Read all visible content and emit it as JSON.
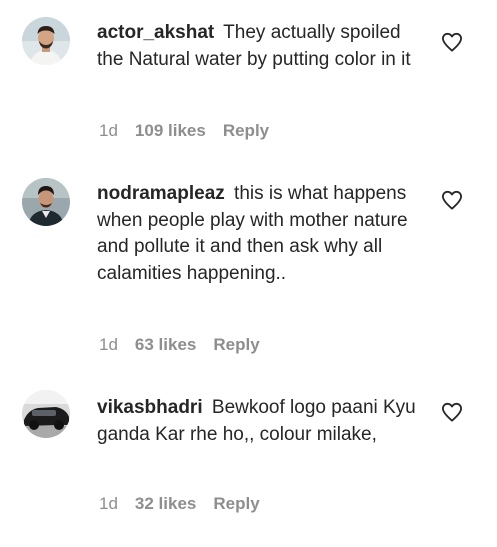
{
  "comments": [
    {
      "username": "actor_akshat",
      "text": "They actually spoiled the Natural water by putting color in it",
      "time": "1d",
      "likes": "109 likes",
      "reply": "Reply",
      "avatar": "avatar-man-beard-white-shirt",
      "like_icon": "heart-outline-icon"
    },
    {
      "username": "nodramapleaz",
      "text": "this is what happens when people play with mother nature and pollute it and then ask why all calamities happening..",
      "time": "1d",
      "likes": "63 likes",
      "reply": "Reply",
      "avatar": "avatar-man-dark-jacket",
      "like_icon": "heart-outline-icon"
    },
    {
      "username": "vikasbhadri",
      "text": "Bewkoof logo paani Kyu ganda Kar rhe ho,, colour milake,",
      "time": "1d",
      "likes": "32 likes",
      "reply": "Reply",
      "avatar": "avatar-car-photo",
      "like_icon": "heart-outline-icon"
    }
  ]
}
